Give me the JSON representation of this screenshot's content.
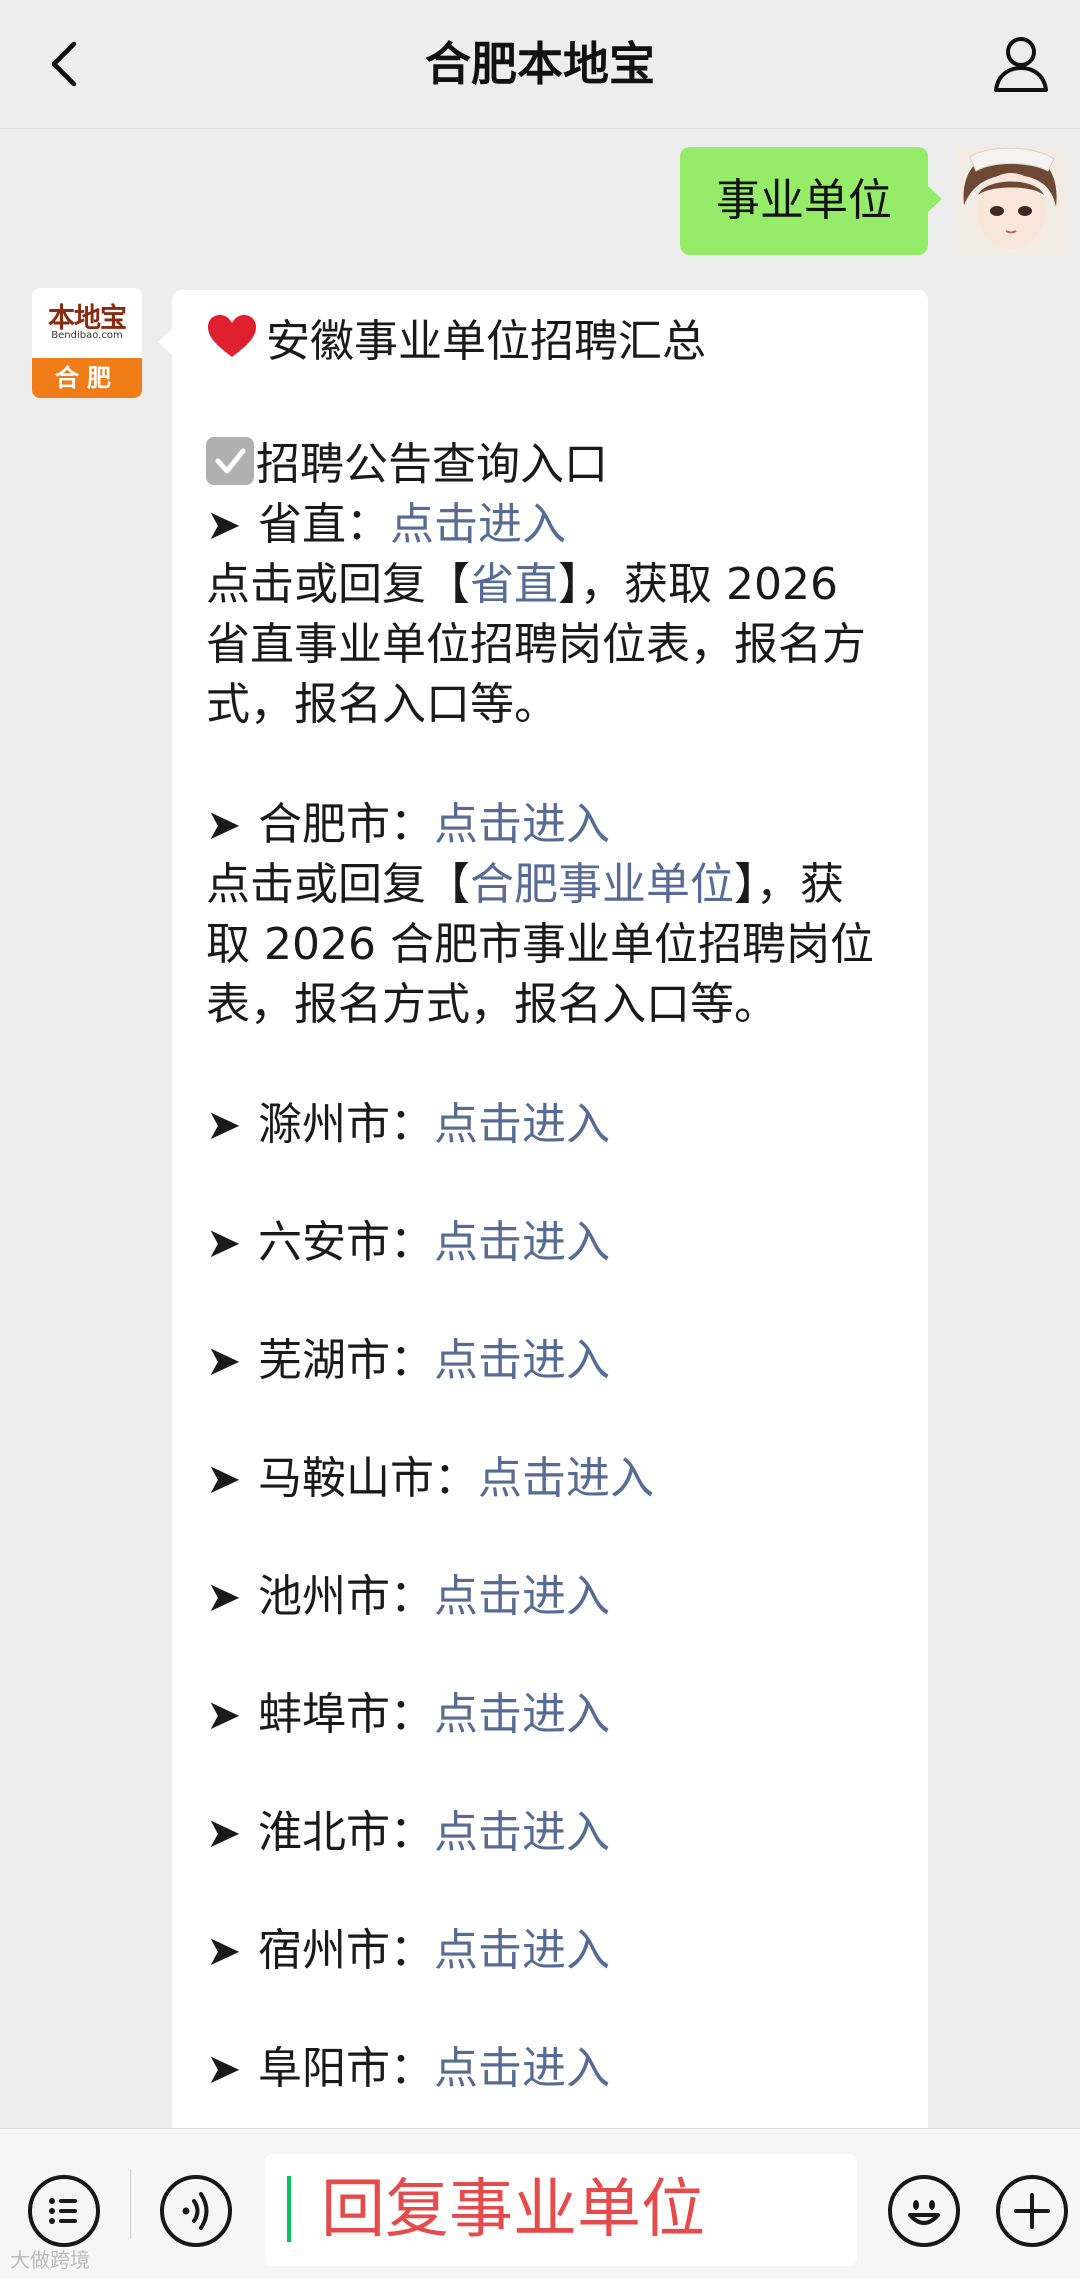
{
  "header": {
    "title": "合肥本地宝"
  },
  "user_message": {
    "text": "事业单位"
  },
  "bot": {
    "avatar": {
      "logo_text": "本地宝",
      "logo_sub": "Bendibao.com",
      "city": "合肥"
    },
    "heading": "安徽事业单位招聘汇总",
    "section_title": "招聘公告查询入口",
    "province": {
      "label": "省直：",
      "link": "点击进入",
      "desc_prefix": "点击或回复【",
      "desc_keyword": "省直",
      "desc_line1_suffix": "】，获取 2026",
      "desc_line2": "省直事业单位招聘岗位表，报名方",
      "desc_line3": "式，报名入口等。"
    },
    "hefei": {
      "label": "合肥市：",
      "link": "点击进入",
      "desc_prefix": "点击或回复【",
      "desc_keyword": "合肥事业单位",
      "desc_line1_suffix": "】，获",
      "desc_line2": "取 2026 合肥市事业单位招聘岗位",
      "desc_line3": "表，报名方式，报名入口等。"
    },
    "regions": [
      {
        "label": "滁州市：",
        "link": "点击进入"
      },
      {
        "label": "六安市：",
        "link": "点击进入"
      },
      {
        "label": "芜湖市：",
        "link": "点击进入"
      },
      {
        "label": "马鞍山市：",
        "link": "点击进入"
      },
      {
        "label": "池州市：",
        "link": "点击进入"
      },
      {
        "label": "蚌埠市：",
        "link": "点击进入"
      },
      {
        "label": "淮北市：",
        "link": "点击进入"
      },
      {
        "label": "宿州市：",
        "link": "点击进入"
      },
      {
        "label": "阜阳市：",
        "link": "点击进入"
      }
    ],
    "arrow": "➤"
  },
  "input": {
    "value": "回复事业单位"
  },
  "watermark": "大做跨境",
  "icons": {
    "back": "chevron-left-icon",
    "profile": "person-icon",
    "heart": "heart-icon",
    "check": "checkbox-icon",
    "menu": "list-menu-icon",
    "voice": "voice-icon",
    "emoji": "emoji-icon",
    "plus": "plus-icon"
  },
  "colors": {
    "user_bubble": "#95ec69",
    "link": "#576b95",
    "input_text": "#e54b4b",
    "brand_orange": "#f07d18"
  }
}
